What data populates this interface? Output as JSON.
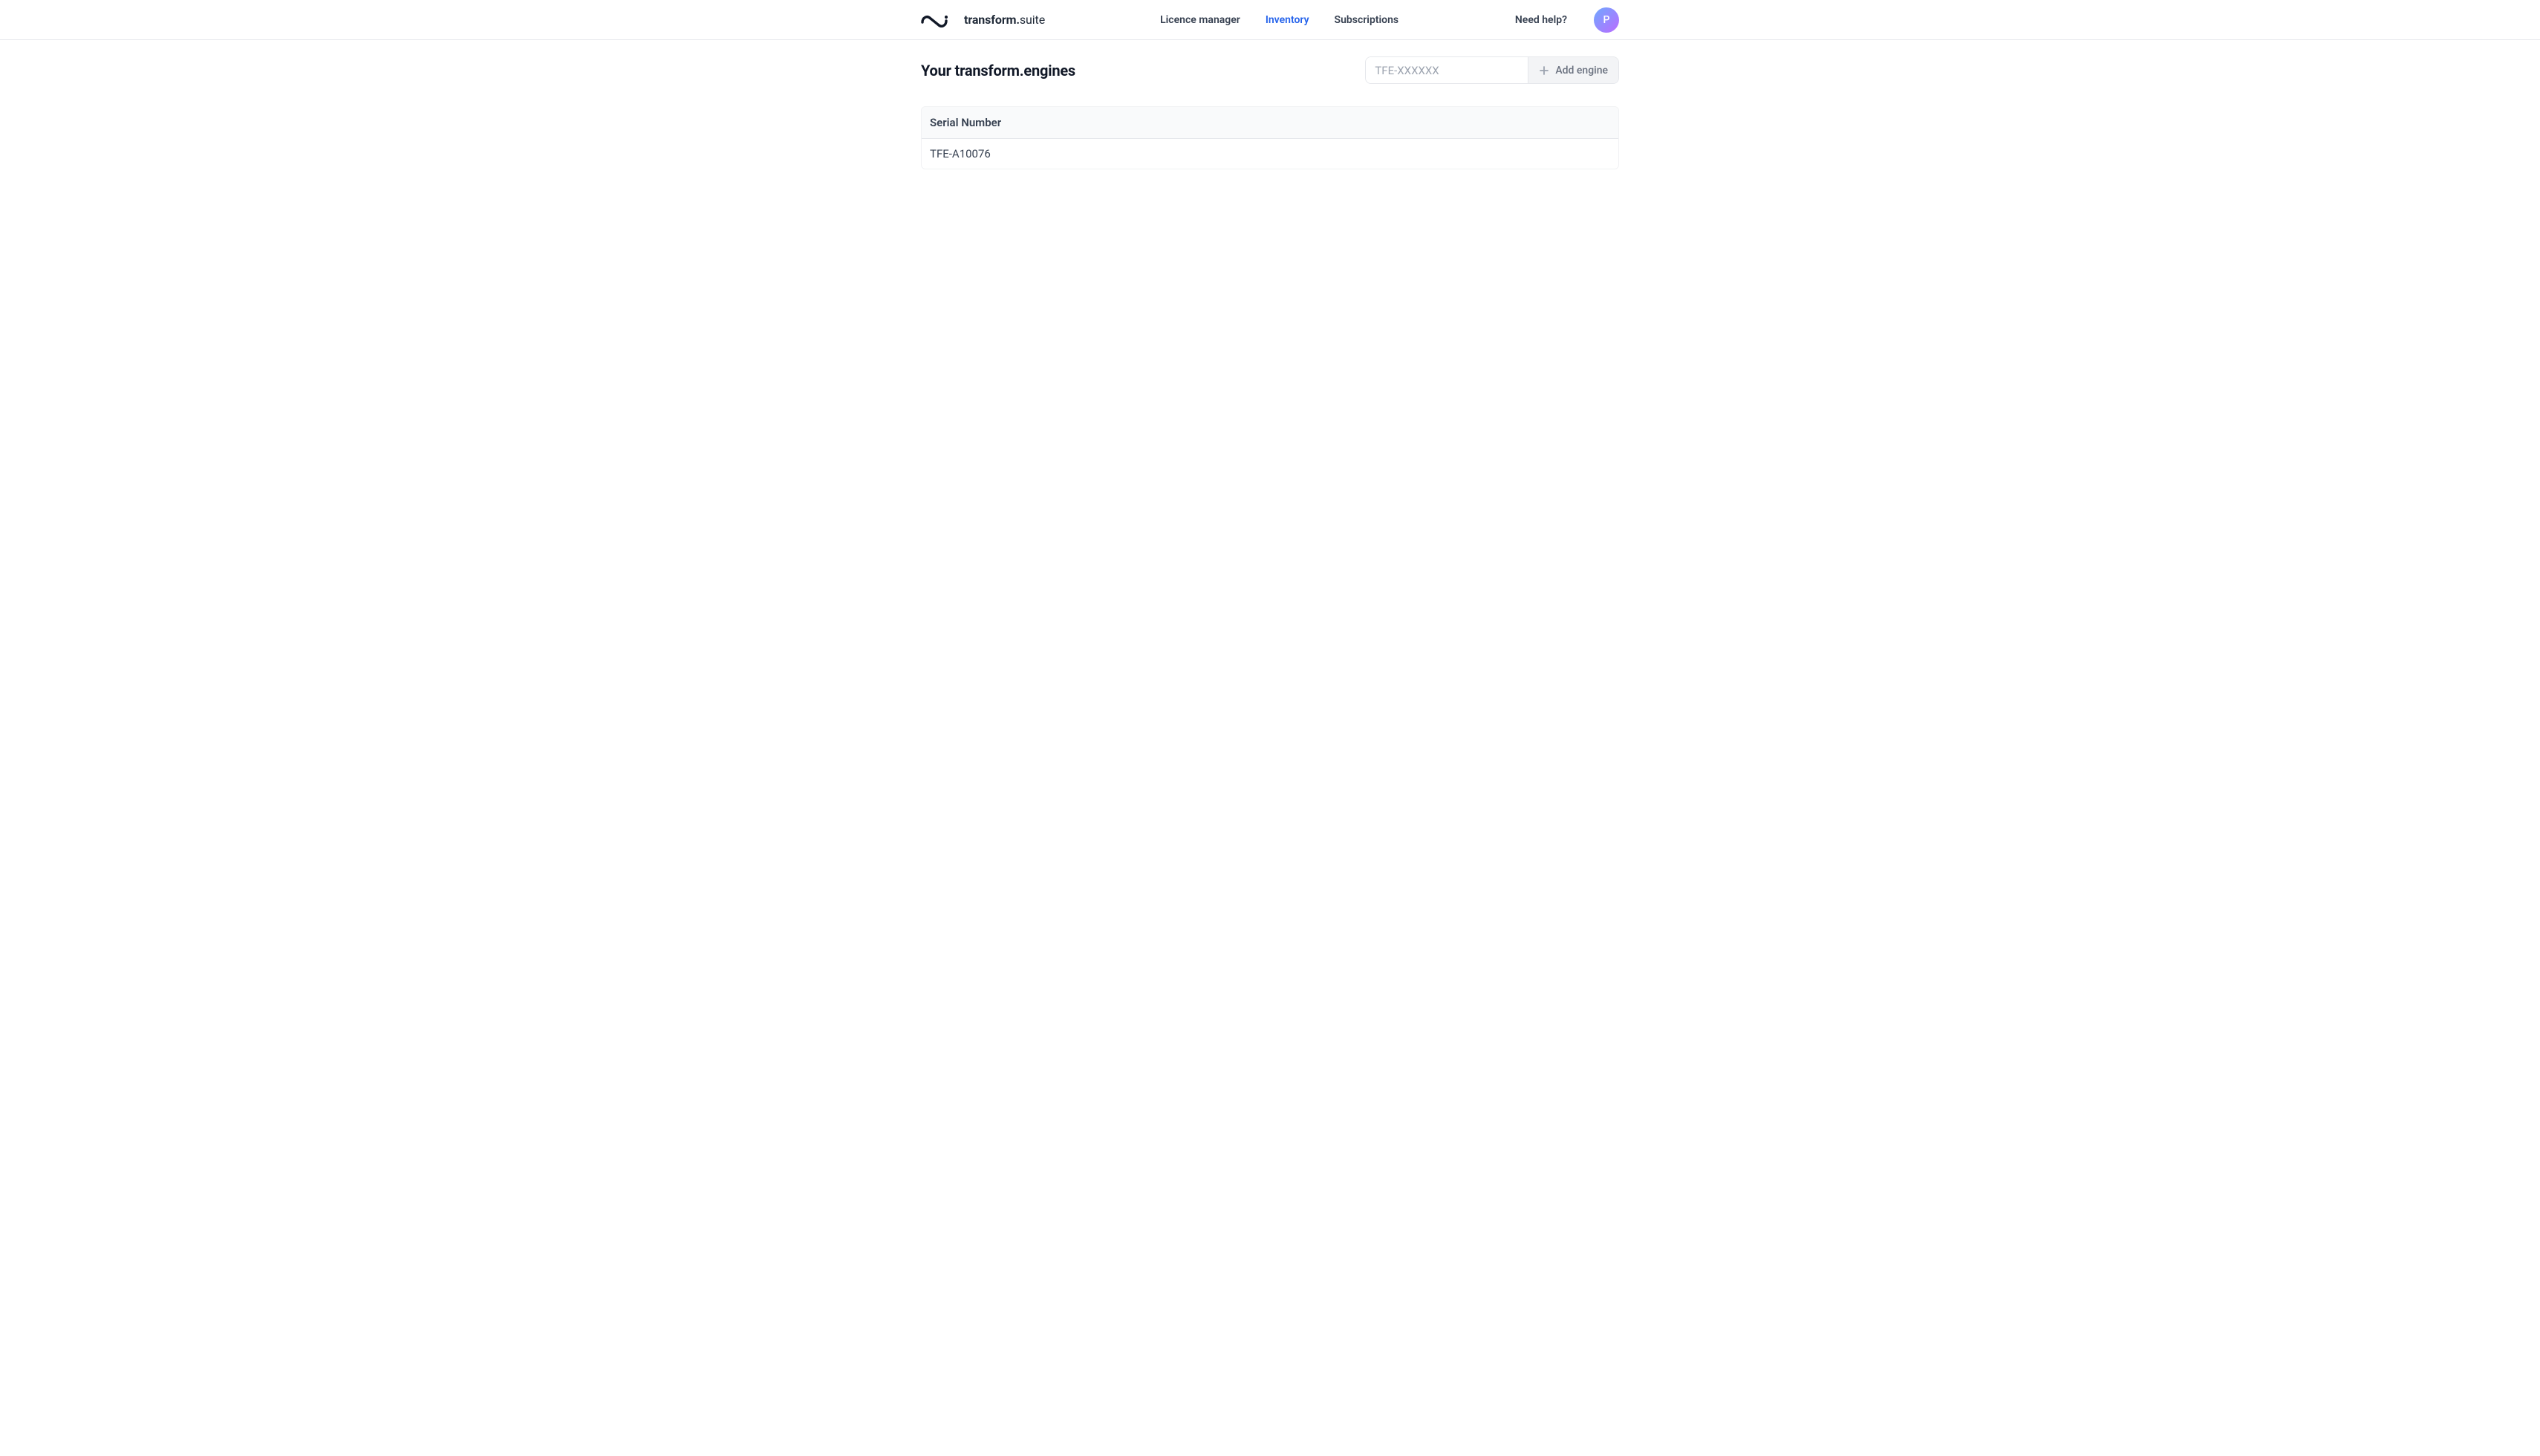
{
  "brand": {
    "bold": "transform.",
    "light": "suite"
  },
  "nav": {
    "items": [
      {
        "label": "Licence manager",
        "active": false
      },
      {
        "label": "Inventory",
        "active": true
      },
      {
        "label": "Subscriptions",
        "active": false
      }
    ]
  },
  "header": {
    "help_label": "Need help?",
    "avatar_initial": "P"
  },
  "main": {
    "title": "Your transform.engines",
    "serial_input": {
      "value": "",
      "placeholder": "TFE-XXXXXX"
    },
    "add_button_label": "Add engine"
  },
  "table": {
    "column_header": "Serial Number",
    "rows": [
      {
        "serial": "TFE-A10076"
      }
    ]
  }
}
